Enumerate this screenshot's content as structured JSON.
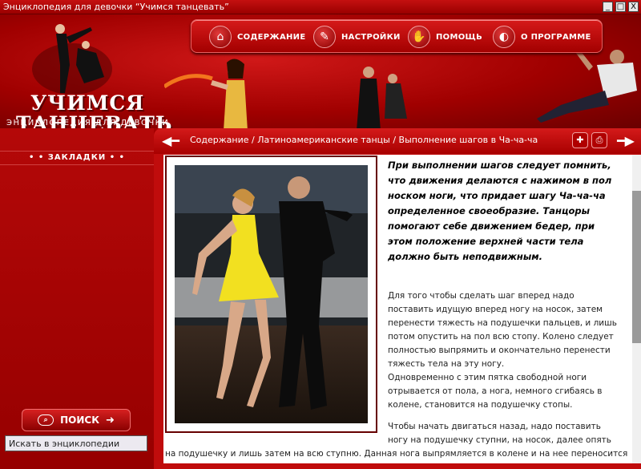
{
  "window": {
    "title": "Энциклопедия для девочки “Учимся танцевать”",
    "minimize": "_",
    "maximize": "□",
    "close": "X"
  },
  "logo": {
    "line1": "УЧИМСЯ",
    "line2": "ТАНЦЕВАТЬ",
    "subtitle": "ЭНЦИКЛОПЕДИЯ ДЛЯ ДЕВОЧКИ"
  },
  "menu": [
    {
      "label": "СОДЕРЖАНИЕ",
      "icon": "home-icon"
    },
    {
      "label": "НАСТРОЙКИ",
      "icon": "wrench-icon"
    },
    {
      "label": "ПОМОЩЬ",
      "icon": "help-icon"
    },
    {
      "label": "О ПРОГРАММЕ",
      "icon": "about-icon"
    }
  ],
  "sidebar": {
    "bookmarks": "• •  ЗАКЛАДКИ  • •",
    "search_button": "ПОИСК",
    "search_value": "Искать в энциклопедии"
  },
  "breadcrumb": "Содержание / Латиноамериканские танцы / Выполнение шагов в Ча-ча-ча",
  "article": {
    "intro": "При выполнении шагов следует помнить, что движения делаются с нажимом в пол носком ноги, что придает шагу Ча-ча-ча определенное своеобразие. Танцоры помогают себе движением бедер, при этом положение верхней части тела должно быть неподвижным.",
    "p1": "Для того чтобы сделать шаг вперед надо поставить идущую вперед ногу на носок, затем перенести тяжесть на подушечки пальцев, и лишь потом опустить на пол всю стопу. Колено следует полностью выпрямить и окончательно перенести тяжесть тела на эту ногу.",
    "p2": "Одновременно с этим пятка свободной ноги отрывается от пола, а нога, немного сгибаясь в колене, становится на подушечку стопы.",
    "p3": "Чтобы начать двигаться назад, надо поставить ногу на подушечку ступни, на носок, далее опять",
    "p4": "на подушечку и лишь затем на всю ступню. Данная нога выпрямляется в колене и на нее переносится"
  },
  "colors": {
    "primary_red": "#b00000",
    "dark_red": "#6a0000"
  }
}
